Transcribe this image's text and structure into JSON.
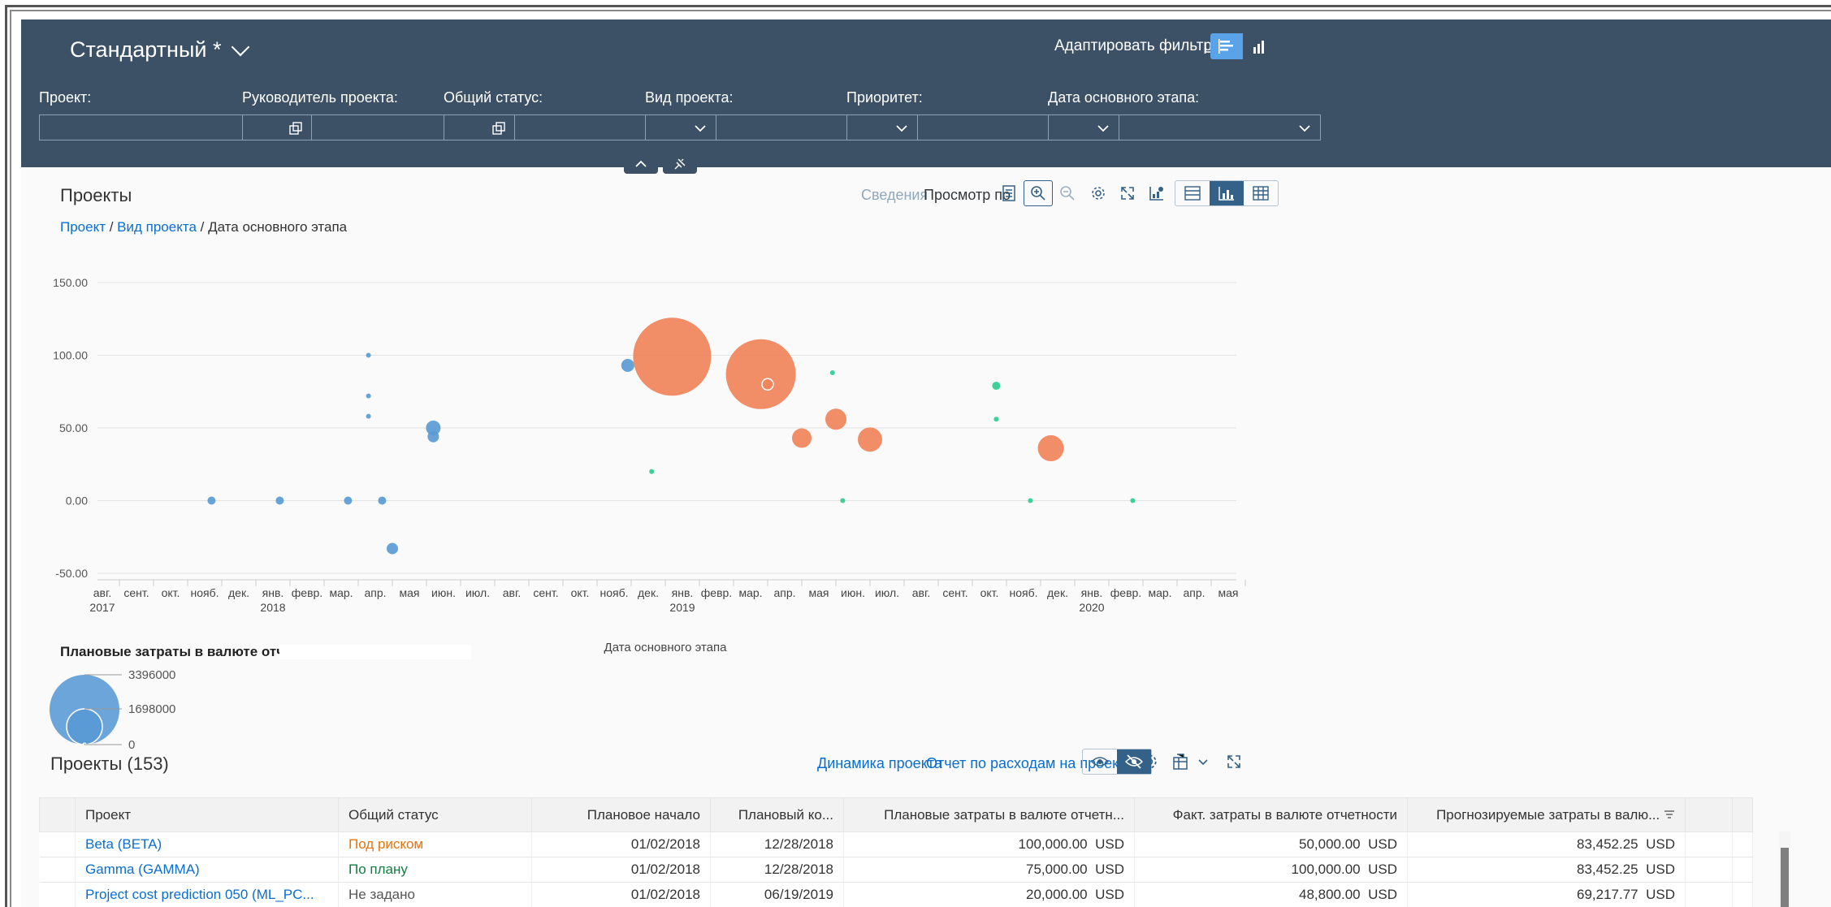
{
  "filterbar": {
    "variant_name": "Стандартный *",
    "adapt_filters": "Адаптировать фильтры",
    "filters": [
      {
        "label": "Проект:",
        "value": "",
        "type": "valuehelp"
      },
      {
        "label": "Руководитель проекта:",
        "value": "",
        "type": "valuehelp"
      },
      {
        "label": "Общий статус:",
        "value": "",
        "type": "dropdown"
      },
      {
        "label": "Вид проекта:",
        "value": "",
        "type": "dropdown"
      },
      {
        "label": "Приоритет:",
        "value": "",
        "type": "dropdown"
      },
      {
        "label": "Дата основного этапа:",
        "value": "",
        "type": "dropdown"
      }
    ]
  },
  "chart_panel": {
    "title": "Проекты",
    "details_link": "Сведения",
    "view_by_link": "Просмотр по",
    "breadcrumb": [
      "Проект",
      " / ",
      "Вид проекта",
      " / ",
      "Дата основного этапа"
    ],
    "legend_title": "Плановые затраты в валюте отчетности",
    "legend_values": [
      "3396000",
      "1698000",
      "0"
    ]
  },
  "chart_data": {
    "type": "scatter",
    "title": "",
    "xlabel": "Дата основного этапа",
    "ylabel": "",
    "ylim": [
      -50,
      150
    ],
    "yticks": [
      "150.00",
      "100.00",
      "50.00",
      "0.00",
      "-50.00"
    ],
    "xticks": [
      {
        "m": "авг.",
        "y": "2017"
      },
      {
        "m": "сент.",
        "y": ""
      },
      {
        "m": "окт.",
        "y": ""
      },
      {
        "m": "нояб.",
        "y": ""
      },
      {
        "m": "дек.",
        "y": ""
      },
      {
        "m": "янв.",
        "y": "2018"
      },
      {
        "m": "февр.",
        "y": ""
      },
      {
        "m": "мар.",
        "y": ""
      },
      {
        "m": "апр.",
        "y": ""
      },
      {
        "m": "мая",
        "y": ""
      },
      {
        "m": "июн.",
        "y": ""
      },
      {
        "m": "июл.",
        "y": ""
      },
      {
        "m": "авг.",
        "y": ""
      },
      {
        "m": "сент.",
        "y": ""
      },
      {
        "m": "окт.",
        "y": ""
      },
      {
        "m": "нояб.",
        "y": ""
      },
      {
        "m": "дек.",
        "y": ""
      },
      {
        "m": "янв.",
        "y": "2019"
      },
      {
        "m": "февр.",
        "y": ""
      },
      {
        "m": "мар.",
        "y": ""
      },
      {
        "m": "апр.",
        "y": ""
      },
      {
        "m": "мая",
        "y": ""
      },
      {
        "m": "июн.",
        "y": ""
      },
      {
        "m": "июл.",
        "y": ""
      },
      {
        "m": "авг.",
        "y": ""
      },
      {
        "m": "сент.",
        "y": ""
      },
      {
        "m": "окт.",
        "y": ""
      },
      {
        "m": "нояб.",
        "y": ""
      },
      {
        "m": "дек.",
        "y": ""
      },
      {
        "m": "янв.",
        "y": "2020"
      },
      {
        "m": "февр.",
        "y": ""
      },
      {
        "m": "мар.",
        "y": ""
      },
      {
        "m": "апр.",
        "y": ""
      },
      {
        "m": "мая",
        "y": ""
      }
    ],
    "colors": {
      "blue": "#5b9bd5",
      "orange": "#f0835a",
      "green": "#2ecc8f"
    },
    "points": [
      {
        "mi": 3.2,
        "y": 0,
        "s": 5,
        "c": "blue"
      },
      {
        "mi": 5.2,
        "y": 0,
        "s": 5,
        "c": "blue"
      },
      {
        "mi": 7.2,
        "y": 0,
        "s": 5,
        "c": "blue"
      },
      {
        "mi": 7.8,
        "y": 100,
        "s": 3,
        "c": "blue"
      },
      {
        "mi": 7.8,
        "y": 72,
        "s": 3,
        "c": "blue"
      },
      {
        "mi": 7.8,
        "y": 58,
        "s": 3,
        "c": "blue"
      },
      {
        "mi": 8.2,
        "y": 0,
        "s": 5,
        "c": "blue"
      },
      {
        "mi": 8.5,
        "y": -33,
        "s": 7,
        "c": "blue"
      },
      {
        "mi": 9.7,
        "y": 50,
        "s": 9,
        "c": "blue"
      },
      {
        "mi": 9.7,
        "y": 44,
        "s": 7,
        "c": "blue"
      },
      {
        "mi": 15.4,
        "y": 93,
        "s": 8,
        "c": "blue"
      },
      {
        "mi": 16.1,
        "y": 20,
        "s": 3,
        "c": "green"
      },
      {
        "mi": 16.7,
        "y": 99,
        "s": 48,
        "c": "orange"
      },
      {
        "mi": 19.3,
        "y": 87,
        "s": 43,
        "c": "orange"
      },
      {
        "mi": 19.5,
        "y": 80,
        "s": 7,
        "c": "orange"
      },
      {
        "mi": 20.5,
        "y": 43,
        "s": 12,
        "c": "orange"
      },
      {
        "mi": 21.4,
        "y": 88,
        "s": 3,
        "c": "green"
      },
      {
        "mi": 21.5,
        "y": 56,
        "s": 13,
        "c": "orange"
      },
      {
        "mi": 21.7,
        "y": 0,
        "s": 3,
        "c": "green"
      },
      {
        "mi": 22.5,
        "y": 42,
        "s": 15,
        "c": "orange"
      },
      {
        "mi": 26.2,
        "y": 79,
        "s": 5,
        "c": "green"
      },
      {
        "mi": 26.2,
        "y": 56,
        "s": 3,
        "c": "green"
      },
      {
        "mi": 27.2,
        "y": 0,
        "s": 3,
        "c": "green"
      },
      {
        "mi": 27.8,
        "y": 36,
        "s": 16,
        "c": "orange"
      },
      {
        "mi": 30.2,
        "y": 0,
        "s": 3,
        "c": "green"
      }
    ]
  },
  "table_panel": {
    "title": "Проекты (153)",
    "link_dynamics": "Динамика проекта",
    "link_costs": "Отчет по расходам на проект",
    "columns": [
      "Проект",
      "Общий статус",
      "Плановое начало",
      "Плановый ко...",
      "Плановые затраты в валюте отчетн...",
      "Факт. затраты в валюте отчетности",
      "Прогнозируемые затраты в валю..."
    ],
    "rows": [
      {
        "project": "Beta (BETA)",
        "status": "Под риском",
        "status_kind": "risk",
        "start": "01/02/2018",
        "end": "12/28/2018",
        "planned": "100,000.00",
        "actual": "50,000.00",
        "forecast": "83,452.25",
        "cur": "USD"
      },
      {
        "project": "Gamma (GAMMA)",
        "status": "По плану",
        "status_kind": "ok",
        "start": "01/02/2018",
        "end": "12/28/2018",
        "planned": "75,000.00",
        "actual": "100,000.00",
        "forecast": "83,452.25",
        "cur": "USD"
      },
      {
        "project": "Project cost prediction 050 (ML_PC...",
        "status": "Не задано",
        "status_kind": "none",
        "start": "01/02/2018",
        "end": "06/19/2019",
        "planned": "20,000.00",
        "actual": "48,800.00",
        "forecast": "69,217.77",
        "cur": "USD"
      }
    ]
  }
}
